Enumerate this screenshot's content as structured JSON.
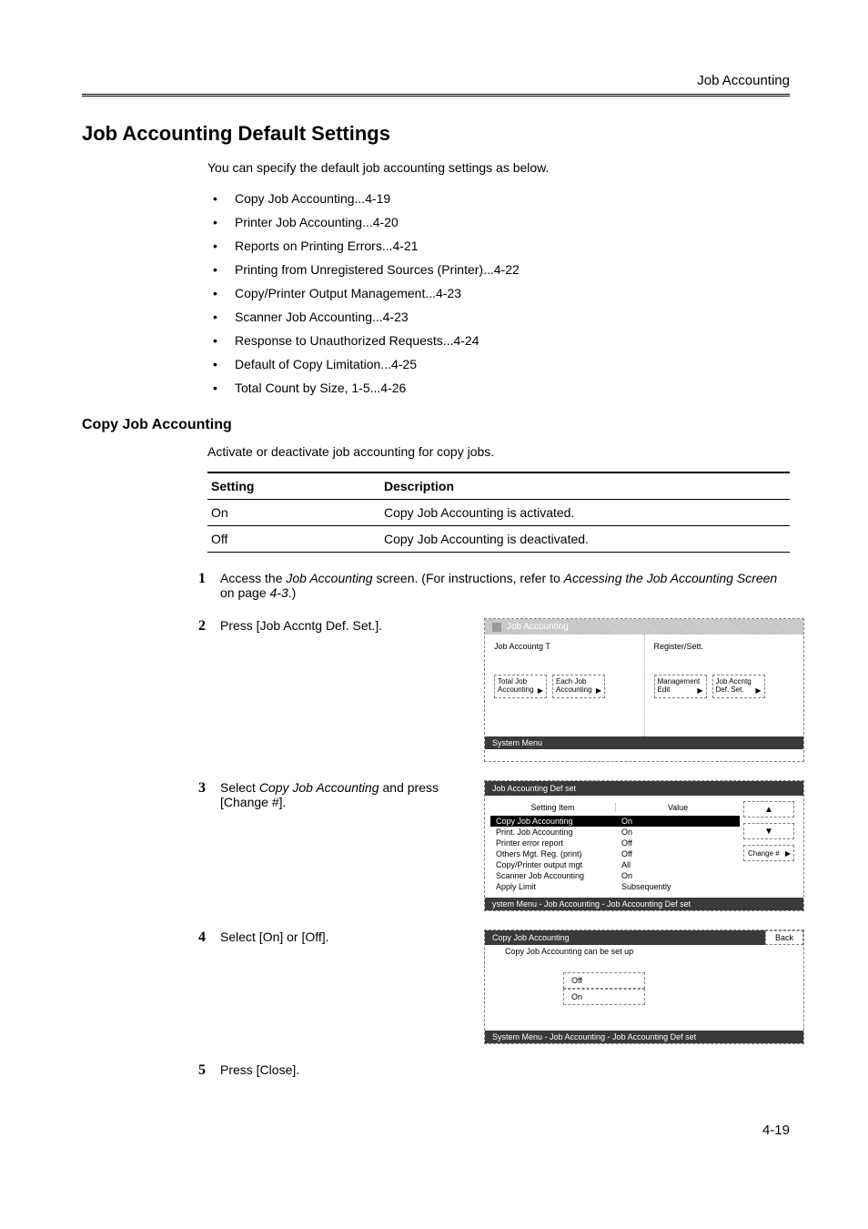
{
  "running_head": "Job Accounting",
  "h1": "Job Accounting Default Settings",
  "intro": "You can specify the default job accounting settings as below.",
  "bullets": [
    "Copy Job Accounting...4-19",
    "Printer Job Accounting...4-20",
    "Reports on Printing Errors...4-21",
    "Printing from Unregistered Sources (Printer)...4-22",
    "Copy/Printer Output Management...4-23",
    "Scanner Job Accounting...4-23",
    "Response to Unauthorized Requests...4-24",
    "Default of Copy Limitation...4-25",
    "Total Count by Size, 1-5...4-26"
  ],
  "h2": "Copy Job Accounting",
  "h2_intro": "Activate or deactivate job accounting for copy jobs.",
  "table": {
    "headers": [
      "Setting",
      "Description"
    ],
    "rows": [
      [
        "On",
        "Copy Job Accounting is activated."
      ],
      [
        "Off",
        "Copy Job Accounting is deactivated."
      ]
    ]
  },
  "steps": {
    "s1_pre": "Access the ",
    "s1_em": "Job Accounting",
    "s1_mid": " screen. (For instructions, refer to ",
    "s1_em2": "Accessing the Job Accounting Screen",
    "s1_post": " on page ",
    "s1_pg": "4-3",
    "s1_end": ".)",
    "s2": "Press [Job Accntg Def. Set.].",
    "s3_pre": "Select ",
    "s3_em": "Copy Job Accounting",
    "s3_post": " and press [Change #].",
    "s4": "Select [On] or [Off].",
    "s5": "Press [Close]."
  },
  "fig1": {
    "title": "Job Accounting",
    "left_label": "Job Accountg T",
    "right_label": "Register/Sett.",
    "btns_left": [
      "Total Job Accounting",
      "Each Job Accounting"
    ],
    "btns_right": [
      "Management Edit",
      "Job Accntg Def. Set."
    ],
    "footer": "System Menu"
  },
  "fig2": {
    "title": "Job Accounting Def set",
    "col1": "Setting Item",
    "col2": "Value",
    "rows": [
      [
        "Copy Job Accounting",
        "On"
      ],
      [
        "Print. Job Accounting",
        "On"
      ],
      [
        "Printer error report",
        "Off"
      ],
      [
        "Others Mgt. Reg. (print)",
        "Off"
      ],
      [
        "Copy/Printer output mgt",
        "All"
      ],
      [
        "Scanner Job Accounting",
        "On"
      ],
      [
        "Apply Limit",
        "Subsequently"
      ]
    ],
    "change": "Change #",
    "footer": "ystem Menu       -  Job Accounting   -   Job Accounting Def set"
  },
  "fig3": {
    "title": "Copy Job Accounting",
    "back": "Back",
    "subtitle": "Copy Job Accounting can be set up",
    "opts": [
      "Off",
      "On"
    ],
    "footer": "System Menu       -  Job Accounting   -   Job Accounting Def set"
  },
  "page_number": "4-19"
}
